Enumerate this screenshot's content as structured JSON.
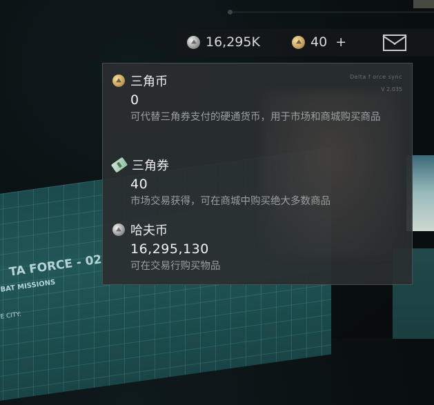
{
  "topbar": {
    "haf_amount": "16,295K",
    "triangle_coin_amount": "40",
    "add_label": "+"
  },
  "tooltip": {
    "faint_text_1": "Delta f   orce sync",
    "faint_text_2": "V    2.035",
    "sections": [
      {
        "title": "三角币",
        "value": "0",
        "desc": "可代替三角券支付的硬通货币，用于市场和商城购买商品",
        "icon": "gold-coin-icon"
      },
      {
        "title": "三角券",
        "value": "40",
        "desc": "市场交易获得，可在商城中购买绝大多数商品",
        "icon": "ticket-icon"
      },
      {
        "title": "哈夫币",
        "value": "16,295,130",
        "desc": "可在交易行购买物品",
        "icon": "silver-coin-icon"
      }
    ]
  },
  "background": {
    "title_text": "TA FORCE - 02",
    "subtitle_text": "BAT MISSIONS",
    "line_text": "E CITY:"
  },
  "colors": {
    "panel_bg": "#2a2e30",
    "desc_text": "#9a9fa1",
    "teal_bg": "#235a5b"
  }
}
